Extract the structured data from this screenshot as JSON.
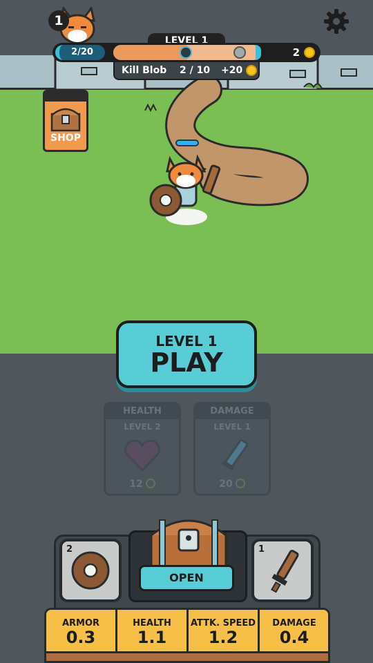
{
  "player": {
    "level_badge": "1"
  },
  "hud": {
    "level_label": "LEVEL 1",
    "xp_text": "2/20",
    "level_progress": 0.5,
    "coins": "2"
  },
  "quest": {
    "name": "Kill Blob",
    "progress": "2 / 10",
    "reward": "+20"
  },
  "shop": {
    "label": "SHOP"
  },
  "play_button": {
    "level": "LEVEL 1",
    "label": "PLAY"
  },
  "upgrades": [
    {
      "title": "HEALTH",
      "level": "LEVEL 2",
      "cost": "12",
      "icon": "heart-icon"
    },
    {
      "title": "DAMAGE",
      "level": "LEVEL 1",
      "cost": "20",
      "icon": "sword-icon"
    }
  ],
  "equipment": {
    "shield_count": "2",
    "sword_count": "1",
    "open_label": "OPEN"
  },
  "stats": [
    {
      "name": "ARMOR",
      "value": "0.3"
    },
    {
      "name": "HEALTH",
      "value": "1.1"
    },
    {
      "name": "ATTK. SPEED",
      "value": "1.2"
    },
    {
      "name": "DAMAGE",
      "value": "0.4"
    }
  ],
  "colors": {
    "accent": "#58cdd5",
    "grass": "#7bbf54",
    "stat_panel": "#f5bf48",
    "background": "#4f575d"
  }
}
